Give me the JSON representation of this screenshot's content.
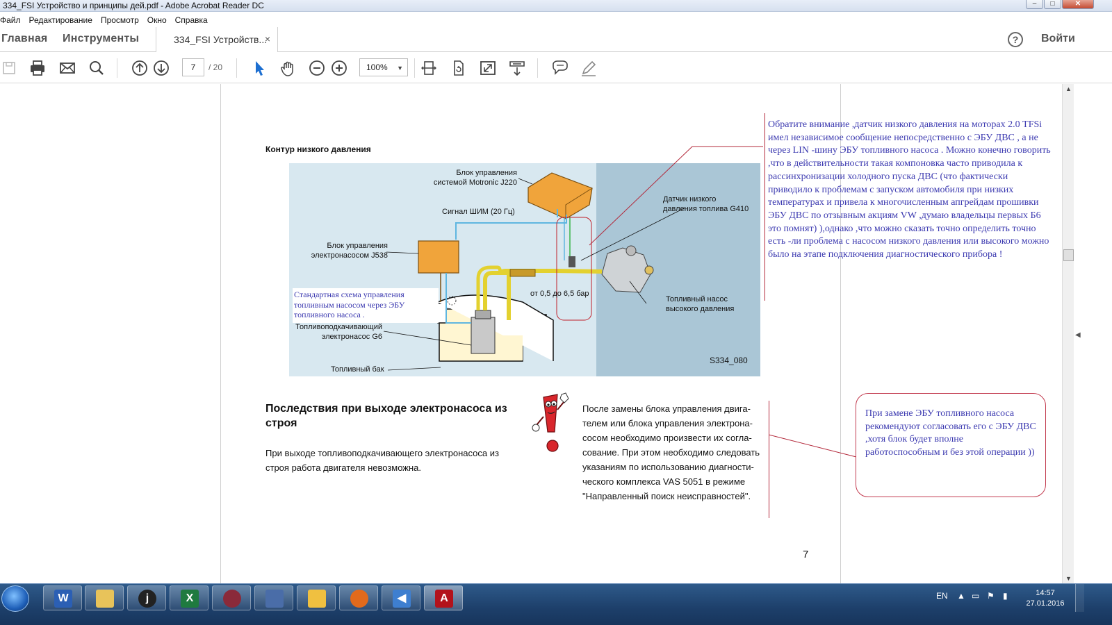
{
  "window": {
    "title": "334_FSI Устройство и принципы дей.pdf - Adobe Acrobat Reader DC",
    "controls": {
      "minimize": "–",
      "maximize": "□",
      "close": "✕"
    }
  },
  "menu": [
    "Файл",
    "Редактирование",
    "Просмотр",
    "Окно",
    "Справка"
  ],
  "tabs": {
    "home": "Главная",
    "tools": "Инструменты",
    "document": "334_FSI Устройств...",
    "close": "×",
    "help": "?",
    "login": "Войти"
  },
  "toolbar": {
    "page_current": "7",
    "page_total": "/ 20",
    "zoom": "100%",
    "icons": [
      "save-icon",
      "print-icon",
      "email-icon",
      "search-icon",
      "page-up-icon",
      "page-down-icon",
      "select-cursor-icon",
      "hand-icon",
      "zoom-out-icon",
      "zoom-in-icon",
      "fit-page-icon",
      "rotate-icon",
      "fullscreen-icon",
      "read-mode-icon",
      "comment-icon",
      "sign-icon"
    ]
  },
  "document": {
    "section_title": "Контур низкого давления",
    "diagram": {
      "label_j220": "Блок управления\nсистемой Motronic J220",
      "label_pwm": "Сигнал ШИМ (20 Гц)",
      "label_j538": "Блок управления\nэлектронасосом J538",
      "label_g410": "Датчик низкого\nдавления топлива G410",
      "label_pressure": "от 0,5 до 6,5 бар",
      "label_hp_pump": "Топливный насос\nвысокого давления",
      "label_g6": "Топливоподкачивающий\nэлектронасос G6",
      "label_tank": "Топливный бак",
      "figure_code": "S334_080",
      "standard_note": "Стандартная схема управления топливным насосом  через ЭБУ топливного насоса ."
    },
    "heading": "Последствия при выходе электронасоса из строя",
    "paragraph1": "При выходе топливоподкачивающего электронасоса из строя работа двигателя невозможна.",
    "paragraph2": "После замены блока управления двига-\nтелем или блока управления электрона-\nсосом необходимо произвести их согла-\nсование. При этом необходимо следовать\nуказаниям по использованию диагности-\nческого комплекса VAS 5051 в режиме\n\"Направленный поиск неисправностей\".",
    "page_number": "7",
    "annotation1": "Обратите внимание   ,датчик низкого давления  на моторах 2.0 TFSi  имел независимое  сообщение непосредственно с ЭБУ ДВС  , а не через LIN -шину ЭБУ топливного насоса  . Можно конечно говорить ,что в действительности такая компоновка   часто приводила к рассинхронизации холодного пуска ДВС  (что фактически приводило к проблемам с запуском автомобиля при низких температурах и привела   к многочисленным апгрейдам  прошивки ЭБУ ДВС по отзывным акциям  VW ,думаю владельцы первых Б6 это помнят) ),однако ,что можно сказать точно определить  точно есть -ли проблема с насосом низкого давления или  высокого можно было на этапе подключения диагностического прибора !",
    "annotation2": "При замене ЭБУ топливного насоса рекомендуют  согласовать его с ЭБУ ДВС ,хотя  блок будет вполне работоспособным и без этой операции ))"
  },
  "taskbar": {
    "apps": [
      "word-icon",
      "file-explorer-icon",
      "java-icon",
      "excel-icon",
      "media-icon",
      "network-icon",
      "folder-icon",
      "firefox-icon",
      "speaker-app-icon",
      "acrobat-icon"
    ],
    "language": "EN",
    "time": "14:57",
    "date": "27.01.2016"
  },
  "colors": {
    "annotation_text": "#3c3ab0",
    "annotation_border": "#c23a4e",
    "diagram_bg": "#d8e8f0",
    "taskbar": "#1d3f6a"
  }
}
